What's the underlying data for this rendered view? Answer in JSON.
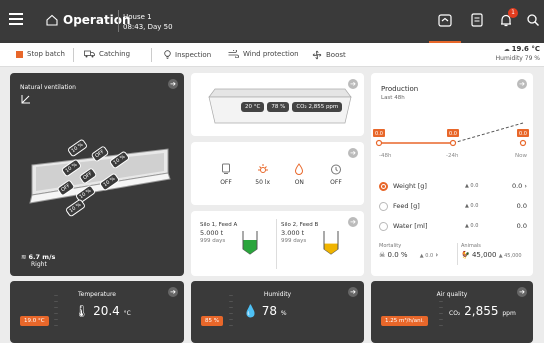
{
  "header": {
    "title": "Operation",
    "house": "House 1",
    "time_day": "08:43, Day 50",
    "notification_count": "1"
  },
  "toolbar": {
    "stop_batch": "Stop batch",
    "catching": "Catching",
    "inspection": "Inspection",
    "wind_protection": "Wind protection",
    "boost": "Boost",
    "outside_temp": "19.6 °C",
    "humidity": "Humidity 79 %"
  },
  "ventilation": {
    "title": "Natural ventilation",
    "wind_speed": "6.7 m/s",
    "wind_dir": "Right",
    "flap_tags": [
      "10 %",
      "OFF",
      "10 %",
      "10 %",
      "OFF",
      "10 %",
      "OFF",
      "10 %",
      "10 %"
    ]
  },
  "house_view": {
    "temp": "20 °C",
    "humidity": "78 %",
    "co2": "CO₂ 2,855 ppm"
  },
  "sensors": [
    {
      "icon": "light-bulb-icon",
      "value": "OFF"
    },
    {
      "icon": "sun-icon",
      "value": "50 lx"
    },
    {
      "icon": "water-drop-icon",
      "value": "ON"
    },
    {
      "icon": "timer-icon",
      "value": "OFF"
    }
  ],
  "silos": [
    {
      "name": "Silo 1, Feed A",
      "amount": "5.000 t",
      "days": "999 days",
      "fill": 0.5,
      "color": "#2aa53c"
    },
    {
      "name": "Silo 2, Feed B",
      "amount": "3.000 t",
      "days": "999 days",
      "fill": 0.3,
      "color": "#f0b400"
    }
  ],
  "production": {
    "title": "Production",
    "subtitle": "Last 48h",
    "markers": [
      "0.0",
      "0.0",
      "0.0"
    ],
    "x_labels": [
      "-48h",
      "-24h",
      "Now"
    ],
    "rows": [
      {
        "name": "Weight [g]",
        "delta": "▲ 0.0",
        "value": "0.0"
      },
      {
        "name": "Feed [g]",
        "delta": "▲ 0.0",
        "value": "0.0"
      },
      {
        "name": "Water [ml]",
        "delta": "▲ 0.0",
        "value": "0.0"
      }
    ],
    "mortality_label": "Mortality",
    "mortality_value": "0.0 %",
    "mortality_delta": "▲ 0.0",
    "animals_label": "Animals",
    "animals_value": "45,000",
    "animals_delta": "▲ 45,000"
  },
  "climate": [
    {
      "title": "Temperature",
      "setpoint": "19.0 °C",
      "value": "20.4",
      "unit": "°C"
    },
    {
      "title": "Humidity",
      "setpoint": "85 %",
      "value": "78",
      "unit": "%"
    },
    {
      "title": "Air quality",
      "setpoint": "1.25 m³/h/ani.",
      "value": "2,855",
      "unit": "ppm"
    }
  ],
  "chart_data": {
    "type": "line",
    "x": [
      "-48h",
      "-24h",
      "Now"
    ],
    "series": [
      {
        "values": [
          0.0,
          0.0,
          0.0
        ]
      }
    ]
  },
  "colors": {
    "accent": "#e8672a",
    "dark": "#3a3a3a"
  }
}
